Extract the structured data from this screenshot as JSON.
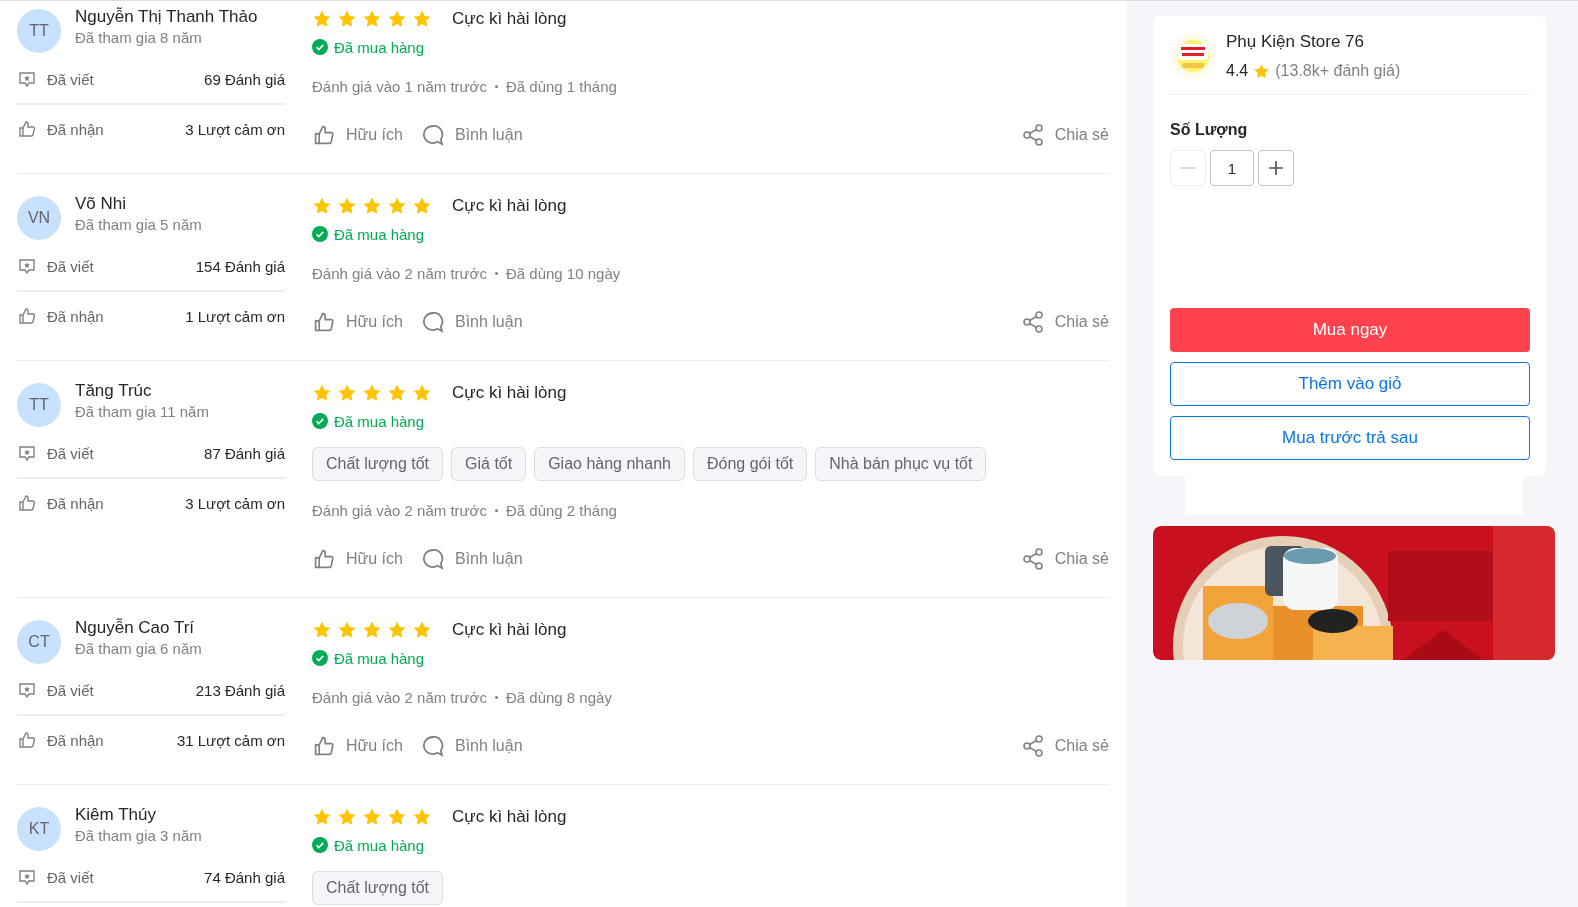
{
  "reviews": [
    {
      "avatar_initials": "TT",
      "name": "Nguyễn Thị Thanh Thảo",
      "joined": "Đã tham gia 8 năm",
      "written_label": "Đã viết",
      "written_count": "69 Đánh giá",
      "received_label": "Đã nhận",
      "received_count": "3 Lượt cảm ơn",
      "stars": 5,
      "rating_text": "Cực kì hài lòng",
      "purchased": true,
      "purchased_label": "Đã mua hàng",
      "review_time": "Đánh giá vào 1 năm trước",
      "usage": "Đã dùng 1 tháng",
      "helpful_label": "Hữu ích",
      "comment_label": "Bình luận",
      "share_label": "Chia sẻ"
    },
    {
      "avatar_initials": "VN",
      "name": "Võ Nhi",
      "joined": "Đã tham gia 5 năm",
      "written_label": "Đã viết",
      "written_count": "154 Đánh giá",
      "received_label": "Đã nhận",
      "received_count": "1 Lượt cảm ơn",
      "stars": 5,
      "rating_text": "Cực kì hài lòng",
      "purchased": true,
      "purchased_label": "Đã mua hàng",
      "review_time": "Đánh giá vào 2 năm trước",
      "usage": "Đã dùng 10 ngày",
      "helpful_label": "Hữu ích",
      "comment_label": "Bình luận",
      "share_label": "Chia sẻ"
    },
    {
      "avatar_initials": "TT",
      "name": "Tăng Trúc",
      "joined": "Đã tham gia 11 năm",
      "written_label": "Đã viết",
      "written_count": "87 Đánh giá",
      "received_label": "Đã nhận",
      "received_count": "3 Lượt cảm ơn",
      "stars": 5,
      "rating_text": "Cực kì hài lòng",
      "purchased": true,
      "purchased_label": "Đã mua hàng",
      "tags": [
        "Chất lượng tốt",
        "Giá tốt",
        "Giao hàng nhanh",
        "Đóng gói tốt",
        "Nhà bán phục vụ tốt"
      ],
      "review_time": "Đánh giá vào 2 năm trước",
      "usage": "Đã dùng 2 tháng",
      "helpful_label": "Hữu ích",
      "comment_label": "Bình luận",
      "share_label": "Chia sẻ"
    },
    {
      "avatar_initials": "CT",
      "name": "Nguyễn Cao Trí",
      "joined": "Đã tham gia 6 năm",
      "written_label": "Đã viết",
      "written_count": "213 Đánh giá",
      "received_label": "Đã nhận",
      "received_count": "31 Lượt cảm ơn",
      "stars": 5,
      "rating_text": "Cực kì hài lòng",
      "purchased": true,
      "purchased_label": "Đã mua hàng",
      "review_time": "Đánh giá vào 2 năm trước",
      "usage": "Đã dùng 8 ngày",
      "helpful_label": "Hữu ích",
      "comment_label": "Bình luận",
      "share_label": "Chia sẻ"
    },
    {
      "avatar_initials": "KT",
      "name": "Kiêm Thúy",
      "joined": "Đã tham gia 3 năm",
      "written_label": "Đã viết",
      "written_count": "74 Đánh giá",
      "stars": 5,
      "rating_text": "Cực kì hài lòng",
      "purchased": true,
      "purchased_label": "Đã mua hàng",
      "tags": [
        "Chất lượng tốt"
      ]
    }
  ],
  "store": {
    "name": "Phụ Kiện Store 76",
    "rating": "4.4",
    "review_count": "(13.8k+ đánh giá)"
  },
  "quantity": {
    "label": "Số Lượng",
    "value": "1",
    "decrease_disabled": true
  },
  "actions": [
    {
      "label": "Mua ngay",
      "kind": "primary"
    },
    {
      "label": "Thêm vào giỏ",
      "kind": "outline"
    },
    {
      "label": "Mua trước trả sau",
      "kind": "outline"
    }
  ]
}
